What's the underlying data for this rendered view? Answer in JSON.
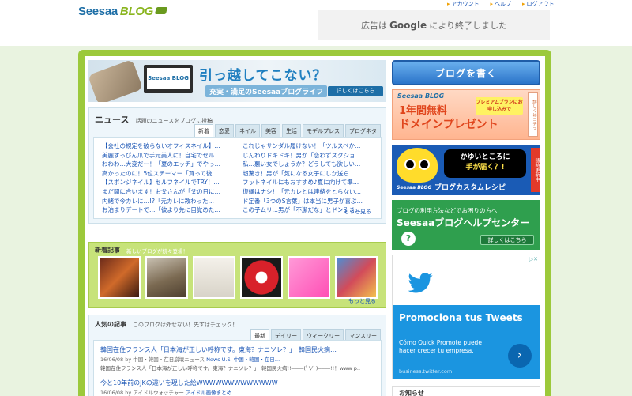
{
  "header": {
    "logo_main": "Seesaa",
    "logo_blog": "BLOG",
    "links": [
      "アカウント",
      "ヘルプ",
      "ログアウト"
    ],
    "ad_prefix": "広告は",
    "ad_google": "Google",
    "ad_suffix": "により終了しました"
  },
  "banner": {
    "screen_text": "Seesaa BLOG",
    "title": "引っ越してこない？",
    "sub": "充実・満足のSeesaaブログライフ",
    "more": "詳しくはこちら"
  },
  "news": {
    "title": "ニュース",
    "desc": "話題のニュースをブログに投稿",
    "tabs": [
      "新着",
      "恋愛",
      "ネイル",
      "美容",
      "生活",
      "モデルプレス",
      "ブログネタ"
    ],
    "left": [
      "【会社の規定を破らないオフィスネイル】…",
      "美麗すっぴん爪で手元美人に！自宅でセル…",
      "わわわ…大変だー！「夏のエッチ」でやっ…",
      "高かったのに！5位スチーマー「買って後…",
      "【スポンジネイル】セルフネイルでTRY！…",
      "まだ間に合います！お父さんが「父の日に…",
      "内緒で今カレに…!?「元カレに教わった…",
      "お泊まりデートで…「彼より先に目覚めた…"
    ],
    "right": [
      "これじゃサンダル履けない！「ツルスベか…",
      "じんわりドキドキ！男が「恋わずスクショ…",
      "私…悪い女でしょうか？どうしても欲しい…",
      "超驚き！男が「気になる女子にしか送ら…",
      "フットネイルにもおすすめ♪夏に向けて準…",
      "復縁はナシ！「元カレとは連絡をとらない…",
      "ド定番「3つのS言葉」は本当に男子が喜ぶ…",
      "この子ムリ…男が「不潔だな」とドン引き…"
    ],
    "more": "もっと見る"
  },
  "newposts": {
    "title": "新着記事",
    "desc": "新しいブログが続々登場！",
    "more": "もっと見る"
  },
  "popular": {
    "title": "人気の記事",
    "desc": "このブログは外せない！先ずはチェック！",
    "tabs": [
      "最新",
      "デイリー",
      "ウィークリー",
      "マンスリー"
    ],
    "items": [
      {
        "title": "韓国在住フランス人「日本海が正しい呼称です。東海？ナニソレ？」　韓国民火病…",
        "meta_prefix": "16/06/08 by 中国・韓国・在日崩壊ニュース",
        "meta_cat": "News U.S. 中国・韓国・在日…",
        "excerpt": "韓国在住フランス人「日本海が正しい呼称です。東海？ナニソレ？」　韓国民火病!!━━━━(ﾟ∀ﾟ)━━━━!!！www p.."
      },
      {
        "title": "今と10年前のJKの違いを現した絵WWWWWWWWWWWWW",
        "meta_prefix": "16/06/08 by アイドルウォッチャー",
        "meta_cat": "アイドル画像まとめ",
        "excerpt": ""
      }
    ]
  },
  "sidebar": {
    "write_button": "ブログを書く",
    "domain": {
      "brand": "Seesaa BLOG",
      "line1": "1年間無料",
      "line2": "ドメインプレゼント",
      "tag": "プレミアムプランにお申し込みで",
      "side": "詳しくはコチラ"
    },
    "custom": {
      "bubble_line1": "かゆいところに",
      "bubble_line2": "手が届く？!",
      "brand": "Seesaa BLOG",
      "foot": "ブログカスタムレシピ",
      "side": "随時更新中"
    },
    "help": {
      "line1": "ブログの利用方法などでお困りの方へ",
      "line2": "Seesaaブログヘルプセンター",
      "more": "詳しくはこちら",
      "icon": "?"
    },
    "twitter_ad": {
      "headline": "Promociona tus Tweets",
      "desc": "Cómo Quick Promote puede hacer crecer tu empresa.",
      "url": "business.twitter.com"
    },
    "notice_title": "お知らせ"
  },
  "colors": {
    "frame": "#9cc93b",
    "link": "#1a55b5",
    "twitter": "#1b95e0"
  }
}
